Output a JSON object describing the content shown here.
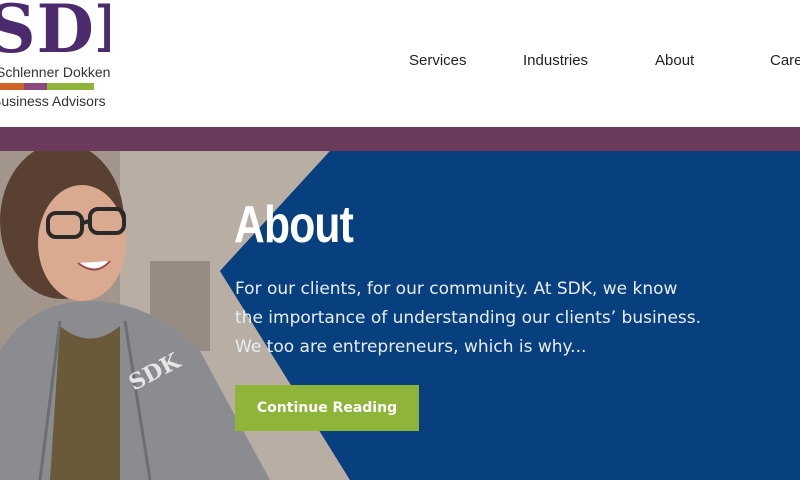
{
  "logo": {
    "mark": "SDK",
    "firm_name": "Schlenner Dokken Kanter",
    "tagline": "Business Advisors",
    "stripe_colors": [
      "#d0632a",
      "#8b4a7e",
      "#8fb43a",
      "#8fb43a"
    ]
  },
  "nav": {
    "items": [
      {
        "label": "Services"
      },
      {
        "label": "Industries"
      },
      {
        "label": "About"
      },
      {
        "label": "Careers"
      }
    ]
  },
  "hero": {
    "title": "About",
    "text": "For our clients, for our community. At SDK, we know the importance of understanding our clients’ business. We too are entrepreneurs, which is why...",
    "cta_label": "Continue Reading",
    "photo_shirt_print": "SDK"
  },
  "colors": {
    "brand_purple": "#4b2a6e",
    "band": "#6b3a5d",
    "hero_blue": "#08407f",
    "cta_green": "#8fb43a"
  }
}
